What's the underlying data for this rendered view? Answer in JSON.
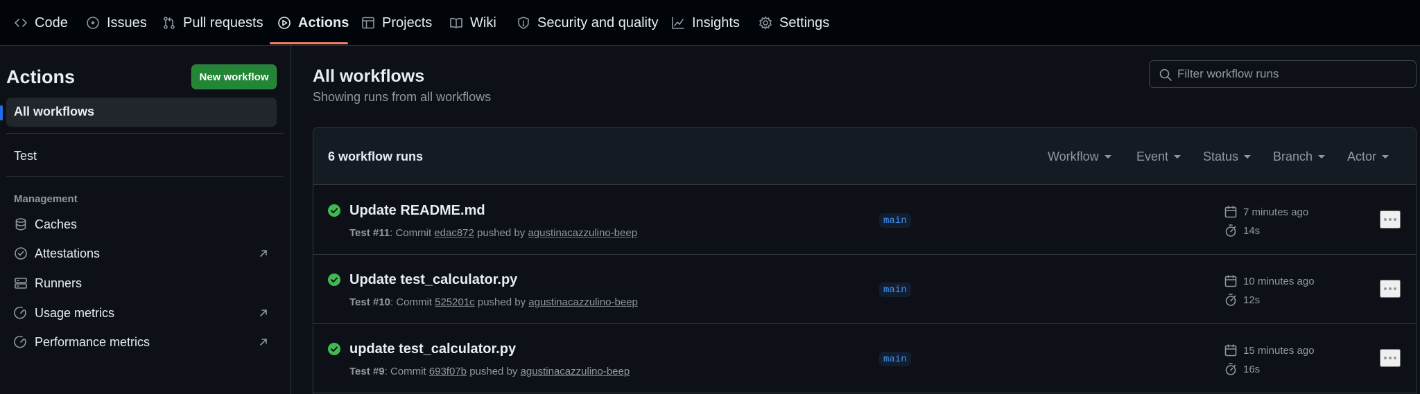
{
  "repo_nav": {
    "tabs": [
      {
        "label": "Code",
        "icon": "code-icon"
      },
      {
        "label": "Issues",
        "icon": "issue-opened-icon"
      },
      {
        "label": "Pull requests",
        "icon": "git-pull-request-icon"
      },
      {
        "label": "Actions",
        "icon": "play-icon",
        "active": true
      },
      {
        "label": "Projects",
        "icon": "table-icon"
      },
      {
        "label": "Wiki",
        "icon": "book-icon"
      },
      {
        "label": "Security and quality",
        "icon": "shield-icon"
      },
      {
        "label": "Insights",
        "icon": "graph-icon"
      },
      {
        "label": "Settings",
        "icon": "gear-icon"
      }
    ]
  },
  "sidebar": {
    "title": "Actions",
    "new_workflow_label": "New workflow",
    "all_workflows_label": "All workflows",
    "workflows": [
      "Test"
    ],
    "management_heading": "Management",
    "management_items": [
      {
        "label": "Caches",
        "icon": "database-icon",
        "external": false
      },
      {
        "label": "Attestations",
        "icon": "verified-icon",
        "external": true
      },
      {
        "label": "Runners",
        "icon": "server-icon",
        "external": false
      },
      {
        "label": "Usage metrics",
        "icon": "meter-icon",
        "external": true
      },
      {
        "label": "Performance metrics",
        "icon": "meter-icon",
        "external": true
      }
    ]
  },
  "main": {
    "title": "All workflows",
    "subtitle": "Showing runs from all workflows",
    "filter_placeholder": "Filter workflow runs",
    "runs_count": "6 workflow runs",
    "filters": [
      "Workflow",
      "Event",
      "Status",
      "Branch",
      "Actor"
    ],
    "runs": [
      {
        "title": "Update README.md",
        "workflow": "Test",
        "number": "#11",
        "commit": "edac872",
        "actor": "agustinacazzulino-beep",
        "branch": "main",
        "time_ago": "7 minutes ago",
        "duration": "14s",
        "status": "success"
      },
      {
        "title": "Update test_calculator.py",
        "workflow": "Test",
        "number": "#10",
        "commit": "525201c",
        "actor": "agustinacazzulino-beep",
        "branch": "main",
        "time_ago": "10 minutes ago",
        "duration": "12s",
        "status": "success"
      },
      {
        "title": "update test_calculator.py",
        "workflow": "Test",
        "number": "#9",
        "commit": "693f07b",
        "actor": "agustinacazzulino-beep",
        "branch": "main",
        "time_ago": "15 minutes ago",
        "duration": "16s",
        "status": "success"
      }
    ],
    "meta_text": {
      "commit_word": "Commit",
      "pushed_by": "pushed by"
    }
  },
  "colors": {
    "background": "#0d1117",
    "nav_background": "#010409",
    "border": "#30363d",
    "primary_button": "#238636",
    "active_tab_underline": "#f78166",
    "success": "#3fb950",
    "branch_text": "#4493f8",
    "muted_text": "#9198a1"
  }
}
